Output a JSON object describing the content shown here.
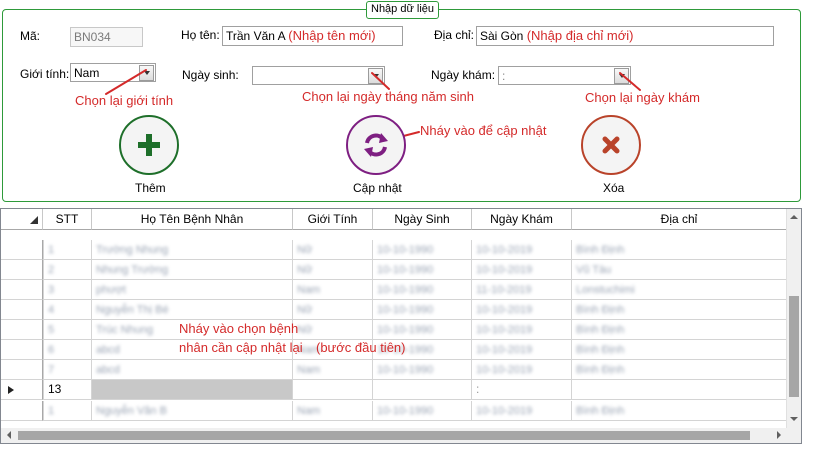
{
  "form": {
    "legend": "Nhập dữ liệu",
    "ma_label": "Mã:",
    "ma_value": "BN034",
    "hoten_label": "Họ tên:",
    "hoten_value": "Trần Văn A",
    "hoten_hint": "(Nhập tên mới)",
    "diachi_label": "Địa chỉ:",
    "diachi_value": "Sài Gòn",
    "diachi_hint": "(Nhập địa chỉ mới)",
    "gioitinh_label": "Giới tính:",
    "gioitinh_value": "Nam",
    "ngaysinh_label": "Ngày sinh:",
    "ngaysinh_value": "",
    "ngaykham_label": "Ngày khám:",
    "ngaykham_value": ":"
  },
  "annotations": {
    "gioitinh": "Chọn lại giới tính",
    "ngaysinh": "Chọn lại ngày tháng năm sinh",
    "ngaykham": "Chọn lại ngày khám",
    "capnhat": "Nháy vào để cập nhật",
    "grid_line1": "Nháy vào chọn bệnh",
    "grid_line2": "nhân cần cập nhật lại",
    "grid_line3": "(bước đầu tiên)"
  },
  "buttons": {
    "them": "Thêm",
    "capnhat": "Cập nhật",
    "xoa": "Xóa"
  },
  "colors": {
    "them": "#1e6f2a",
    "capnhat": "#7e1f82",
    "xoa": "#b9432a",
    "annotation": "#d42a2a",
    "groupbox": "#2e9a3a"
  },
  "grid": {
    "columns": [
      "STT",
      "Họ Tên Bệnh Nhân",
      "Giới Tính",
      "Ngày Sinh",
      "Ngày Khám",
      "Địa chỉ"
    ],
    "blurred_rows": [
      [
        "1",
        "Trường Nhung",
        "Nữ",
        "10-10-1990",
        "10-10-2019",
        "Bình Định"
      ],
      [
        "2",
        "Nhung Trường",
        "Nữ",
        "10-10-1990",
        "10-10-2019",
        "Vũ Tàu"
      ],
      [
        "3",
        "phượt",
        "Nam",
        "10-10-1990",
        "11-10-2019",
        "Lonstuchimi"
      ],
      [
        "4",
        "Nguyễn Thị Bé",
        "Nữ",
        "10-10-1990",
        "10-10-2019",
        "Bình Định"
      ],
      [
        "5",
        "Trúc Nhung",
        "Nữ",
        "10-10-1990",
        "10-10-2019",
        "Bình Định"
      ],
      [
        "6",
        "abcd",
        "Nam",
        "10-10-1990",
        "10-10-2019",
        "Bình Định"
      ],
      [
        "7",
        "abcd",
        "Nam",
        "10-10-1990",
        "10-10-2019",
        "Bình Định"
      ]
    ],
    "selected_row_stt": "13",
    "selected_row_ngaykham": ":",
    "last_row": [
      "1",
      "Nguyễn Văn B",
      "Nam",
      "10-10-1990",
      "10-10-2019",
      "Bình Định"
    ]
  }
}
